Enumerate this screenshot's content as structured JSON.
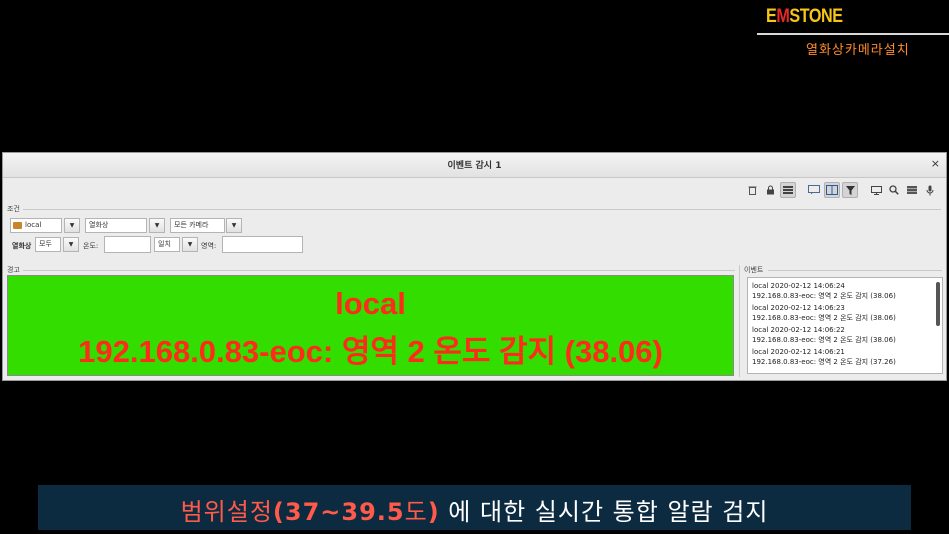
{
  "brand": {
    "logo_pre": "E",
    "logo_m": "M",
    "logo_post": "STONE",
    "subtitle": "열화상카메라설치"
  },
  "window": {
    "title": "이벤트 감시 1",
    "close_label": "×"
  },
  "toolbar": {
    "icons": [
      "trash-icon",
      "lock-icon",
      "list-icon",
      "chat-icon",
      "split-view-icon",
      "filter-icon",
      "monitor-icon",
      "search-icon",
      "grid-icon",
      "microphone-icon"
    ]
  },
  "condition": {
    "label": "조건",
    "site": "local",
    "type": "열화상",
    "camera": "모든 카메라",
    "thermal_label": "열화상",
    "thermal_value": "모두",
    "temp_label": "온도:",
    "temp_value": "",
    "op": "일치",
    "area_label": "영역:",
    "area_value": ""
  },
  "alert": {
    "label": "경고",
    "line1": "local",
    "line2": "192.168.0.83-eoc: 영역 2 온도 감지 (38.06)",
    "bg_color": "#33dd00",
    "text_color": "#ff2a1a"
  },
  "events": {
    "label": "이벤트",
    "items": [
      {
        "head": "local 2020-02-12 14:06:24",
        "body": "192.168.0.83-eoc: 영역 2 온도 감지 (38.06)"
      },
      {
        "head": "local 2020-02-12 14:06:23",
        "body": "192.168.0.83-eoc: 영역 2 온도 감지 (38.06)"
      },
      {
        "head": "local 2020-02-12 14:06:22",
        "body": "192.168.0.83-eoc: 영역 2 온도 감지 (38.06)"
      },
      {
        "head": "local 2020-02-12 14:06:21",
        "body": "192.168.0.83-eoc: 영역 2 온도 감지 (37.26)"
      }
    ]
  },
  "caption": {
    "part1": "범위설정",
    "part2": "(37~39.5",
    "part3": "도",
    "part4": ")",
    "part5": " 에 대한 실시간 통합 알람 검지"
  }
}
